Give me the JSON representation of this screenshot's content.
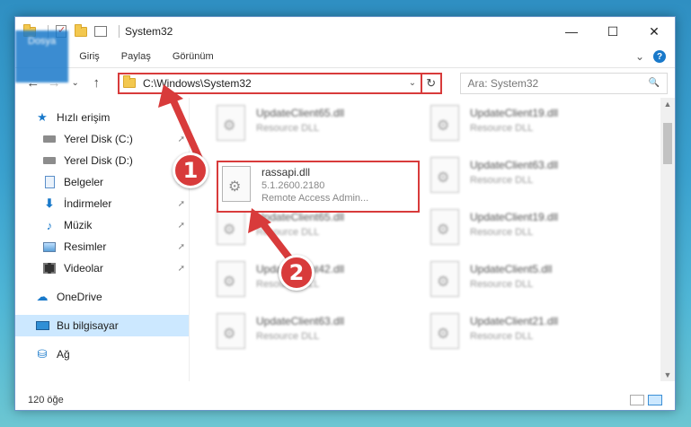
{
  "window": {
    "title": "System32",
    "controls": {
      "minimize": "—",
      "maximize": "☐",
      "close": "✕"
    }
  },
  "ribbon": {
    "tabs": [
      "Dosya",
      "Giriş",
      "Paylaş",
      "Görünüm"
    ],
    "expand": "⌄",
    "help": "?"
  },
  "nav": {
    "back": "←",
    "forward": "→",
    "recent": "⌄",
    "up": "↑",
    "address": "C:\\Windows\\System32",
    "address_drop": "⌄",
    "refresh": "↻",
    "search_placeholder": "Ara: System32",
    "search_icon": "🔍"
  },
  "sidebar": {
    "quick_access": "Hızlı erişim",
    "items": [
      {
        "label": "Yerel Disk (C:)",
        "icon": "drive-icon",
        "pinned": true
      },
      {
        "label": "Yerel Disk (D:)",
        "icon": "drive-icon",
        "pinned": true
      },
      {
        "label": "Belgeler",
        "icon": "documents-icon",
        "pinned": true
      },
      {
        "label": "İndirmeler",
        "icon": "download-icon",
        "pinned": true
      },
      {
        "label": "Müzik",
        "icon": "music-icon",
        "pinned": true
      },
      {
        "label": "Resimler",
        "icon": "pictures-icon",
        "pinned": true
      },
      {
        "label": "Videolar",
        "icon": "videos-icon",
        "pinned": true
      }
    ],
    "onedrive": "OneDrive",
    "this_pc": "Bu bilgisayar",
    "network": "Ağ",
    "pin_glyph": "📌"
  },
  "files": {
    "left": [
      {
        "name": "UpdateClient65.dll",
        "sub": "Resource DLL"
      },
      {
        "name": "",
        "sub": ""
      },
      {
        "name": "UpdateClient65.dll",
        "sub": "Resource DLL"
      },
      {
        "name": "UpdateClient42.dll",
        "sub": "Resource DLL"
      },
      {
        "name": "UpdateClient63.dll",
        "sub": "Resource DLL"
      }
    ],
    "right": [
      {
        "name": "UpdateClient19.dll",
        "sub": "Resource DLL"
      },
      {
        "name": "UpdateClient63.dll",
        "sub": "Resource DLL"
      },
      {
        "name": "UpdateClient19.dll",
        "sub": "Resource DLL"
      },
      {
        "name": "UpdateClient5.dll",
        "sub": "Resource DLL"
      },
      {
        "name": "UpdateClient21.dll",
        "sub": "Resource DLL"
      }
    ],
    "highlight": {
      "name": "rassapi.dll",
      "version": "5.1.2600.2180",
      "description": "Remote Access Admin..."
    }
  },
  "status": {
    "count": "120 öğe"
  },
  "badges": [
    "1",
    "2"
  ],
  "colors": {
    "accent": "#1979ca",
    "highlight": "#d83b3b",
    "selected": "#cce8ff"
  }
}
